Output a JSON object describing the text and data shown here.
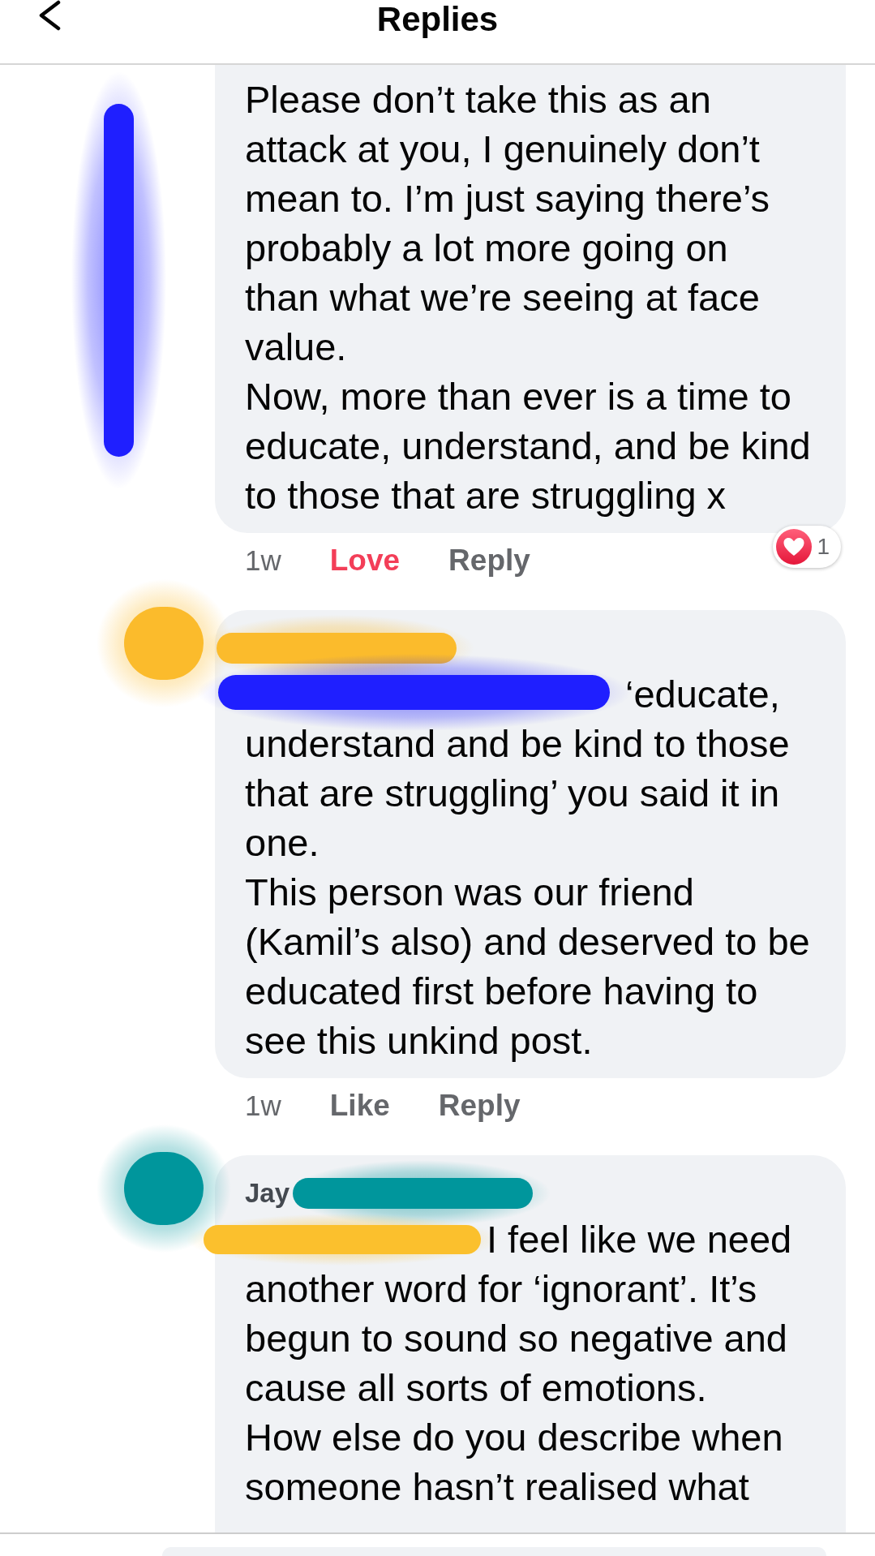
{
  "header": {
    "title": "Replies"
  },
  "comments": [
    {
      "redactions": [
        {
          "kind": "gutter",
          "color": "#1f1fff"
        }
      ],
      "paragraphs": [
        "Please don’t take this as an attack at you, I genuinely don’t mean to. I’m just saying there’s probably a lot more going on than what we’re seeing at face value.",
        "Now, more than ever is a time to educate, understand, and be kind to those that are struggling x"
      ],
      "time": "1w",
      "react_button": {
        "label": "Love",
        "reacted": true
      },
      "reply_button": "Reply",
      "reactions": {
        "kind": "love",
        "count": "1"
      }
    },
    {
      "redactions": [
        {
          "kind": "avatar",
          "color": "#fbbb2c"
        },
        {
          "kind": "author",
          "color": "#fbbb2c"
        },
        {
          "kind": "mention",
          "color": "#1f1fff"
        }
      ],
      "paragraphs": [
        "‘educate, understand and be kind to those that are struggling’ you said it in one.",
        "This person was our friend (Kamil’s also) and deserved to be educated first before having to see this unkind post."
      ],
      "time": "1w",
      "react_button": {
        "label": "Like",
        "reacted": false
      },
      "reply_button": "Reply"
    },
    {
      "author": "Jay",
      "redactions": [
        {
          "kind": "avatar",
          "color": "#00969c"
        },
        {
          "kind": "author",
          "color": "#00969c"
        },
        {
          "kind": "tag",
          "color": "#fbc02d"
        }
      ],
      "paragraphs": [
        "I feel like we need another word for ‘ignorant’. It’s begun to sound so negative and cause all sorts of emotions.",
        "How else do you describe when someone hasn’t realised what"
      ]
    }
  ]
}
